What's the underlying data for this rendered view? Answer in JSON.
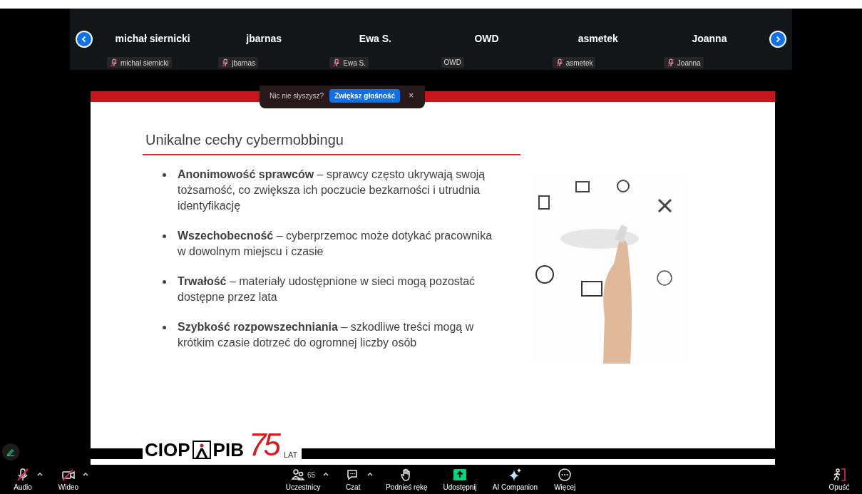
{
  "gallery": {
    "participants": [
      {
        "name": "michał siernicki",
        "tag": "michał siernicki",
        "muted": true
      },
      {
        "name": "jbarnas",
        "tag": "jbarnas",
        "muted": true
      },
      {
        "name": "Ewa S.",
        "tag": "Ewa S.",
        "muted": true
      },
      {
        "name": "OWD",
        "tag": "OWD",
        "muted": false
      },
      {
        "name": "asmetek",
        "tag": "asmetek",
        "muted": true
      },
      {
        "name": "Joanna",
        "tag": "Joanna",
        "muted": true
      }
    ]
  },
  "notification": {
    "text": "Nic nie słyszysz?",
    "button": "Zwiększ głośność",
    "close": "×"
  },
  "slide": {
    "title": "Unikalne cechy cybermobbingu",
    "bullets": [
      "**Anonimowość sprawców** – sprawcy często ukrywają swoją tożsamość, co zwiększa ich poczucie bezkarności i utrudnia identyfikację",
      "**Wszechobecność** – cyberprzemoc może dotykać pracownika w dowolnym miejscu i czasie",
      "**Trwałość** – materiały udostępnione w sieci mogą pozostać dostępne przez lata",
      "**Szybkość rozpowszechniania** – szkodliwe treści mogą w krótkim czasie dotrzeć do ogromnej liczby osób"
    ],
    "logo": {
      "left": "CIOP",
      "right": "PIB",
      "number": "75",
      "suffix": "LAT"
    }
  },
  "toolbar": {
    "left": [
      {
        "kind": "mic",
        "label": "Audio",
        "off": true,
        "menu": true
      },
      {
        "kind": "camera",
        "label": "Wideo",
        "off": true,
        "menu": true
      }
    ],
    "center": [
      {
        "kind": "participants",
        "label": "Uczestnicy",
        "count": "65",
        "menu": true
      },
      {
        "kind": "chat",
        "label": "Czat",
        "menu": true
      },
      {
        "kind": "hand",
        "label": "Podnieś rękę",
        "menu": false
      },
      {
        "kind": "share",
        "label": "Udostępnij",
        "menu": false
      },
      {
        "kind": "sparkle",
        "label": "AI Companion",
        "menu": false
      },
      {
        "kind": "more",
        "label": "Więcej",
        "menu": false
      }
    ],
    "right": [
      {
        "kind": "leave",
        "label": "Opuść",
        "menu": false
      }
    ]
  }
}
